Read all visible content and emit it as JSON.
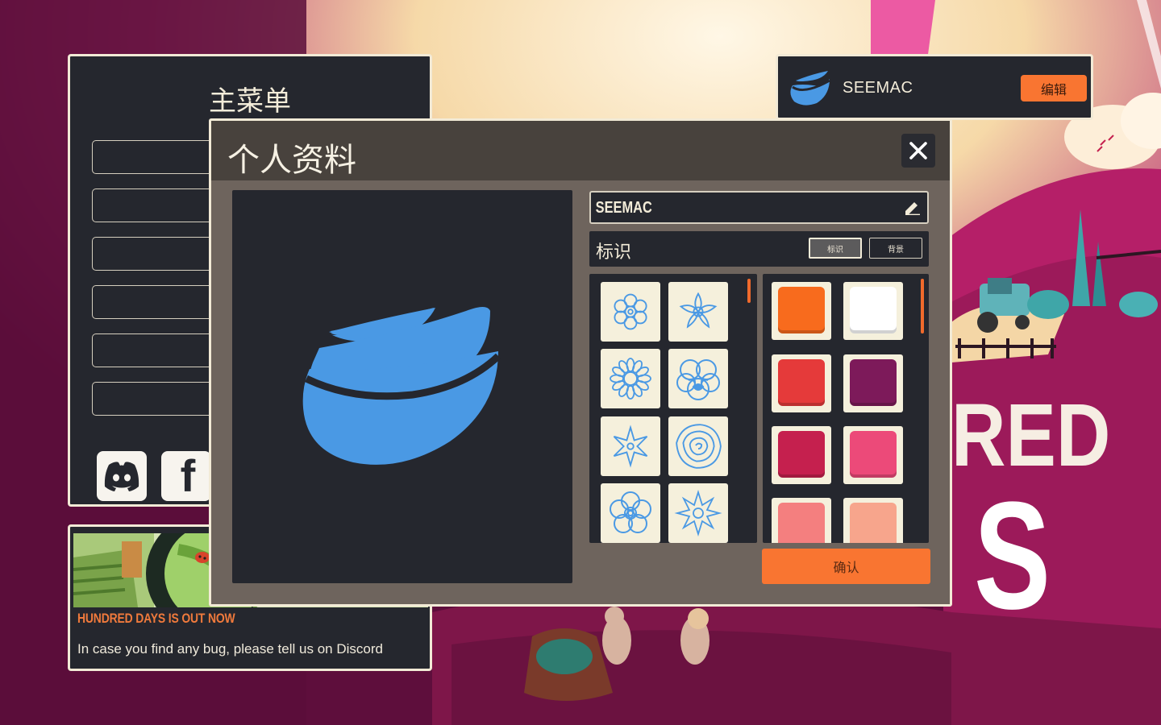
{
  "main_menu": {
    "title": "主菜单",
    "button_count": 6,
    "social": [
      {
        "icon": "discord-icon"
      },
      {
        "icon": "facebook-icon",
        "glyph": "f"
      }
    ]
  },
  "news": {
    "headline": "HUNDRED DAYS IS OUT NOW",
    "body": "In case you find any bug, please tell us on Discord"
  },
  "user_bar": {
    "username": "SEEMAC",
    "edit_label": "编辑",
    "logo_color": "#4a99e4"
  },
  "background": {
    "title_fragment_1": "RED",
    "title_fragment_2": "S"
  },
  "profile_dialog": {
    "title": "个人资料",
    "close_glyph": "✕",
    "name_value": "SEEMAC",
    "section_label": "标识",
    "tabs": [
      {
        "label": "标识",
        "active": true
      },
      {
        "label": "背景",
        "active": false
      }
    ],
    "icons": [
      "flower-1-icon",
      "flower-2-icon",
      "flower-3-icon",
      "pansy-icon",
      "star-flower-icon",
      "rose-icon",
      "flower-5-icon",
      "star-burst-icon"
    ],
    "icon_color": "#4a99e4",
    "colors": [
      "#f86b1d",
      "#ffffff",
      "#e53a3a",
      "#7d1a5a",
      "#c5204e",
      "#ec4a79",
      "#f47f7f",
      "#f7a58c"
    ],
    "confirm_label": "确认"
  }
}
